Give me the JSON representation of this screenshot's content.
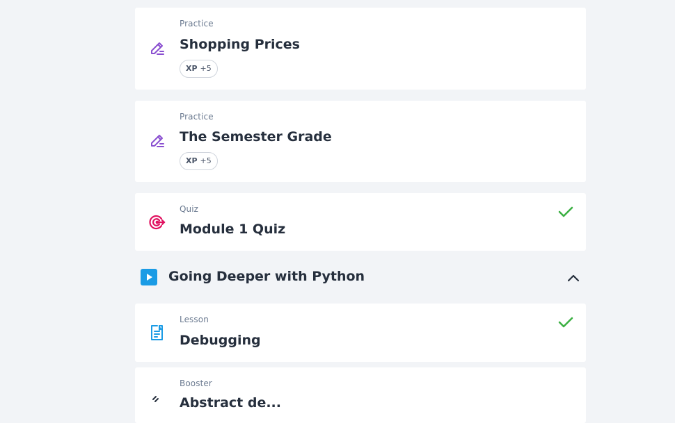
{
  "items": [
    {
      "type": "Practice",
      "title": "Shopping Prices",
      "xp_label": "XP",
      "xp_value": "+5",
      "icon": "pencil-icon",
      "completed": false
    },
    {
      "type": "Practice",
      "title": "The Semester Grade",
      "xp_label": "XP",
      "xp_value": "+5",
      "icon": "pencil-icon",
      "completed": false
    },
    {
      "type": "Quiz",
      "title": "Module 1 Quiz",
      "icon": "target-icon",
      "completed": true
    },
    {
      "type": "Lesson",
      "title": "Debugging",
      "icon": "lesson-doc-icon",
      "completed": true
    },
    {
      "type": "Booster",
      "title": "Abstract de...",
      "icon": "booster-icon",
      "completed": false
    }
  ],
  "section": {
    "title": "Going Deeper with Python",
    "icon": "play-icon",
    "expanded": true
  },
  "colors": {
    "practice_icon": "#8a4fd0",
    "quiz_icon": "#e0115f",
    "lesson_icon": "#1a9be5",
    "check": "#3cb043",
    "background": "#f2f4f7"
  }
}
